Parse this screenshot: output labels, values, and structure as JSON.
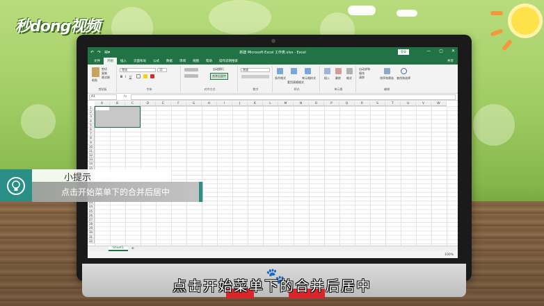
{
  "logo": {
    "text": "秒dong视频"
  },
  "excel": {
    "doc_title": "新建 Microsoft Excel 工作表.xlsx  -  Excel",
    "login_label": "登录",
    "qat": [
      "↶",
      "↷",
      "⊞▾"
    ],
    "window_buttons": [
      "—",
      "▢",
      "✕"
    ],
    "tabs": [
      "文件",
      "开始",
      "插入",
      "页面布局",
      "公式",
      "数据",
      "审阅",
      "视图",
      "帮助"
    ],
    "active_tab": "开始",
    "tell_me": "操作说明搜索",
    "share": "共享",
    "ribbon": {
      "clipboard": {
        "label": "剪贴板",
        "paste": "粘贴",
        "cut": "剪切",
        "copy": "复制",
        "format_painter": "格式刷"
      },
      "font": {
        "label": "字体",
        "font_name": "等线",
        "font_size": "11",
        "bold": "B",
        "italic": "I",
        "underline": "U"
      },
      "alignment": {
        "label": "对齐方式",
        "wrap": "自动换行",
        "merge": "合并后居中"
      },
      "number": {
        "label": "数字",
        "format": "常规"
      },
      "styles": {
        "label": "样式",
        "cond": "条件格式",
        "table": "套用表格格式",
        "cell": "单元格样式"
      },
      "cells": {
        "label": "单元格",
        "insert": "插入",
        "delete": "删除",
        "format": "格式"
      },
      "editing": {
        "label": "编辑",
        "autosum": "自动求和",
        "fill": "填充",
        "clear": "清除",
        "sort": "排序和筛选",
        "find": "查找和选择"
      }
    },
    "name_box": "A1",
    "fx": "fx",
    "columns": [
      "A",
      "B",
      "C",
      "D",
      "E",
      "F",
      "G",
      "H",
      "I",
      "J",
      "K",
      "L",
      "M",
      "N",
      "O",
      "P",
      "Q",
      "R",
      "S",
      "T",
      "U",
      "V",
      "W"
    ],
    "rows": [
      "1",
      "2",
      "3",
      "4",
      "5",
      "6",
      "7",
      "8",
      "9",
      "10",
      "11",
      "12",
      "13",
      "14",
      "15",
      "16",
      "17",
      "18",
      "19",
      "20",
      "21",
      "22",
      "23",
      "24",
      "25",
      "26",
      "27",
      "28",
      "29",
      "30",
      "31",
      "32"
    ],
    "sheet_tab": "Sheet1",
    "add_sheet": "⊕",
    "zoom": "100%"
  },
  "hint": {
    "title": "小提示",
    "body": "点击开始菜单下的合并后居中"
  },
  "subtitle": "点击开始菜单下的合并后居中",
  "colors": {
    "excel_green": "#217346",
    "hint_teal": "#2a8f87"
  }
}
